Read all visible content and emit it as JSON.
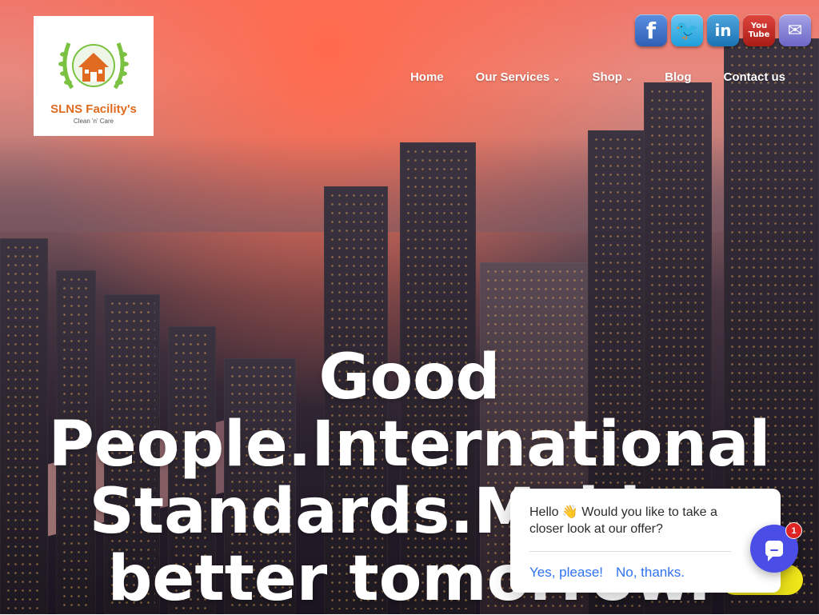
{
  "logo": {
    "title": "SLNS Facility's",
    "subtitle": "Clean 'n' Care",
    "icon": "house-laurel-logo",
    "colors": {
      "laurel": "#7cc242",
      "house": "#e06a1f"
    }
  },
  "social": [
    {
      "name": "facebook",
      "glyph": "f",
      "icon": "facebook-icon"
    },
    {
      "name": "twitter",
      "glyph": "🐦",
      "icon": "twitter-icon"
    },
    {
      "name": "linkedin",
      "glyph": "in",
      "icon": "linkedin-icon"
    },
    {
      "name": "youtube",
      "glyph_top": "You",
      "glyph_bottom": "Tube",
      "icon": "youtube-icon"
    },
    {
      "name": "email",
      "glyph": "✉",
      "icon": "mail-icon"
    }
  ],
  "nav": {
    "home": "Home",
    "services": "Our Services",
    "shop": "Shop",
    "blog": "Blog",
    "contact": "Contact us",
    "chevron": "⌄"
  },
  "hero": {
    "line1": "Good",
    "line2": "People.International",
    "line3": "Standards.Making",
    "line4": "better tomorrow."
  },
  "chat": {
    "message": "Hello 👋 Would you like to take a closer look at our offer?",
    "yes": "Yes, please!",
    "no": "No, thanks.",
    "badge": "1",
    "accent": "#4b4ee6",
    "link_color": "#2f73f2"
  }
}
